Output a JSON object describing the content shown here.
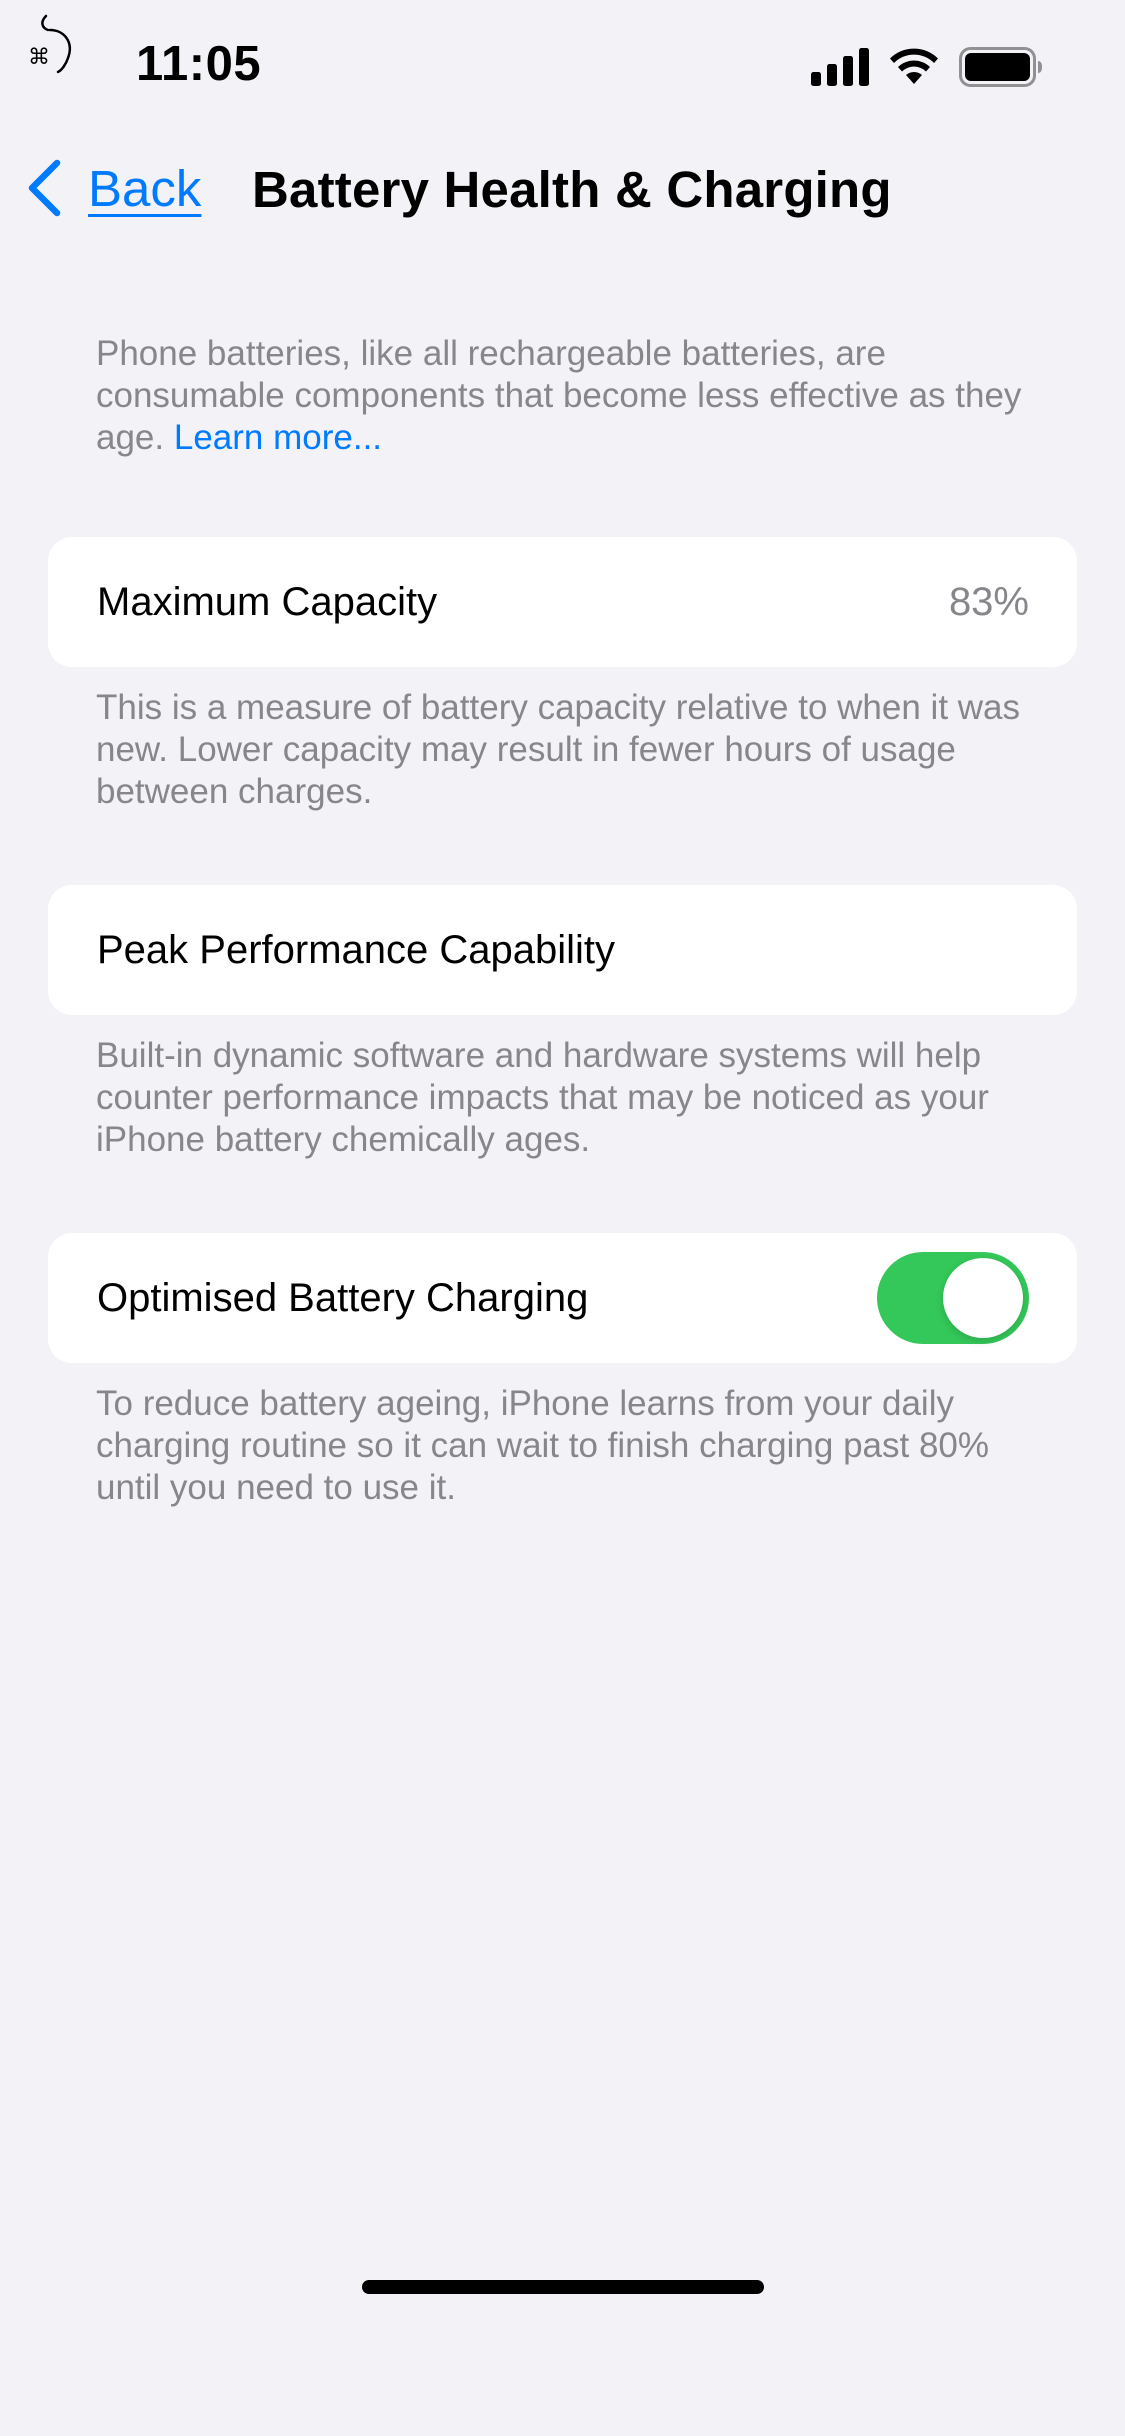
{
  "status_bar": {
    "time": "11:05",
    "icons": [
      "app-notification-icon",
      "cellular-signal-icon",
      "wifi-icon",
      "battery-icon"
    ]
  },
  "nav": {
    "back_label": "Back",
    "title": "Battery Health & Charging"
  },
  "intro": {
    "text": "Phone batteries, like all rechargeable batteries, are consumable components that become less effective as they age.",
    "link_label": "Learn more..."
  },
  "maximum_capacity": {
    "label": "Maximum Capacity",
    "value": "83%",
    "footer": "This is a measure of battery capacity relative to when it was new. Lower capacity may result in fewer hours of usage between charges."
  },
  "peak_performance": {
    "label": "Peak Performance Capability",
    "footer": "Built-in dynamic software and hardware systems will help counter performance impacts that may be noticed as your iPhone battery chemically ages."
  },
  "optimised_charging": {
    "label": "Optimised Battery Charging",
    "enabled": true,
    "footer": "To reduce battery ageing, iPhone learns from your daily charging routine so it can wait to finish charging past 80% until you need to use it."
  },
  "colors": {
    "background": "#f2f2f7",
    "accent": "#007aff",
    "toggle_on": "#34c759",
    "secondary_text": "#86868b"
  }
}
